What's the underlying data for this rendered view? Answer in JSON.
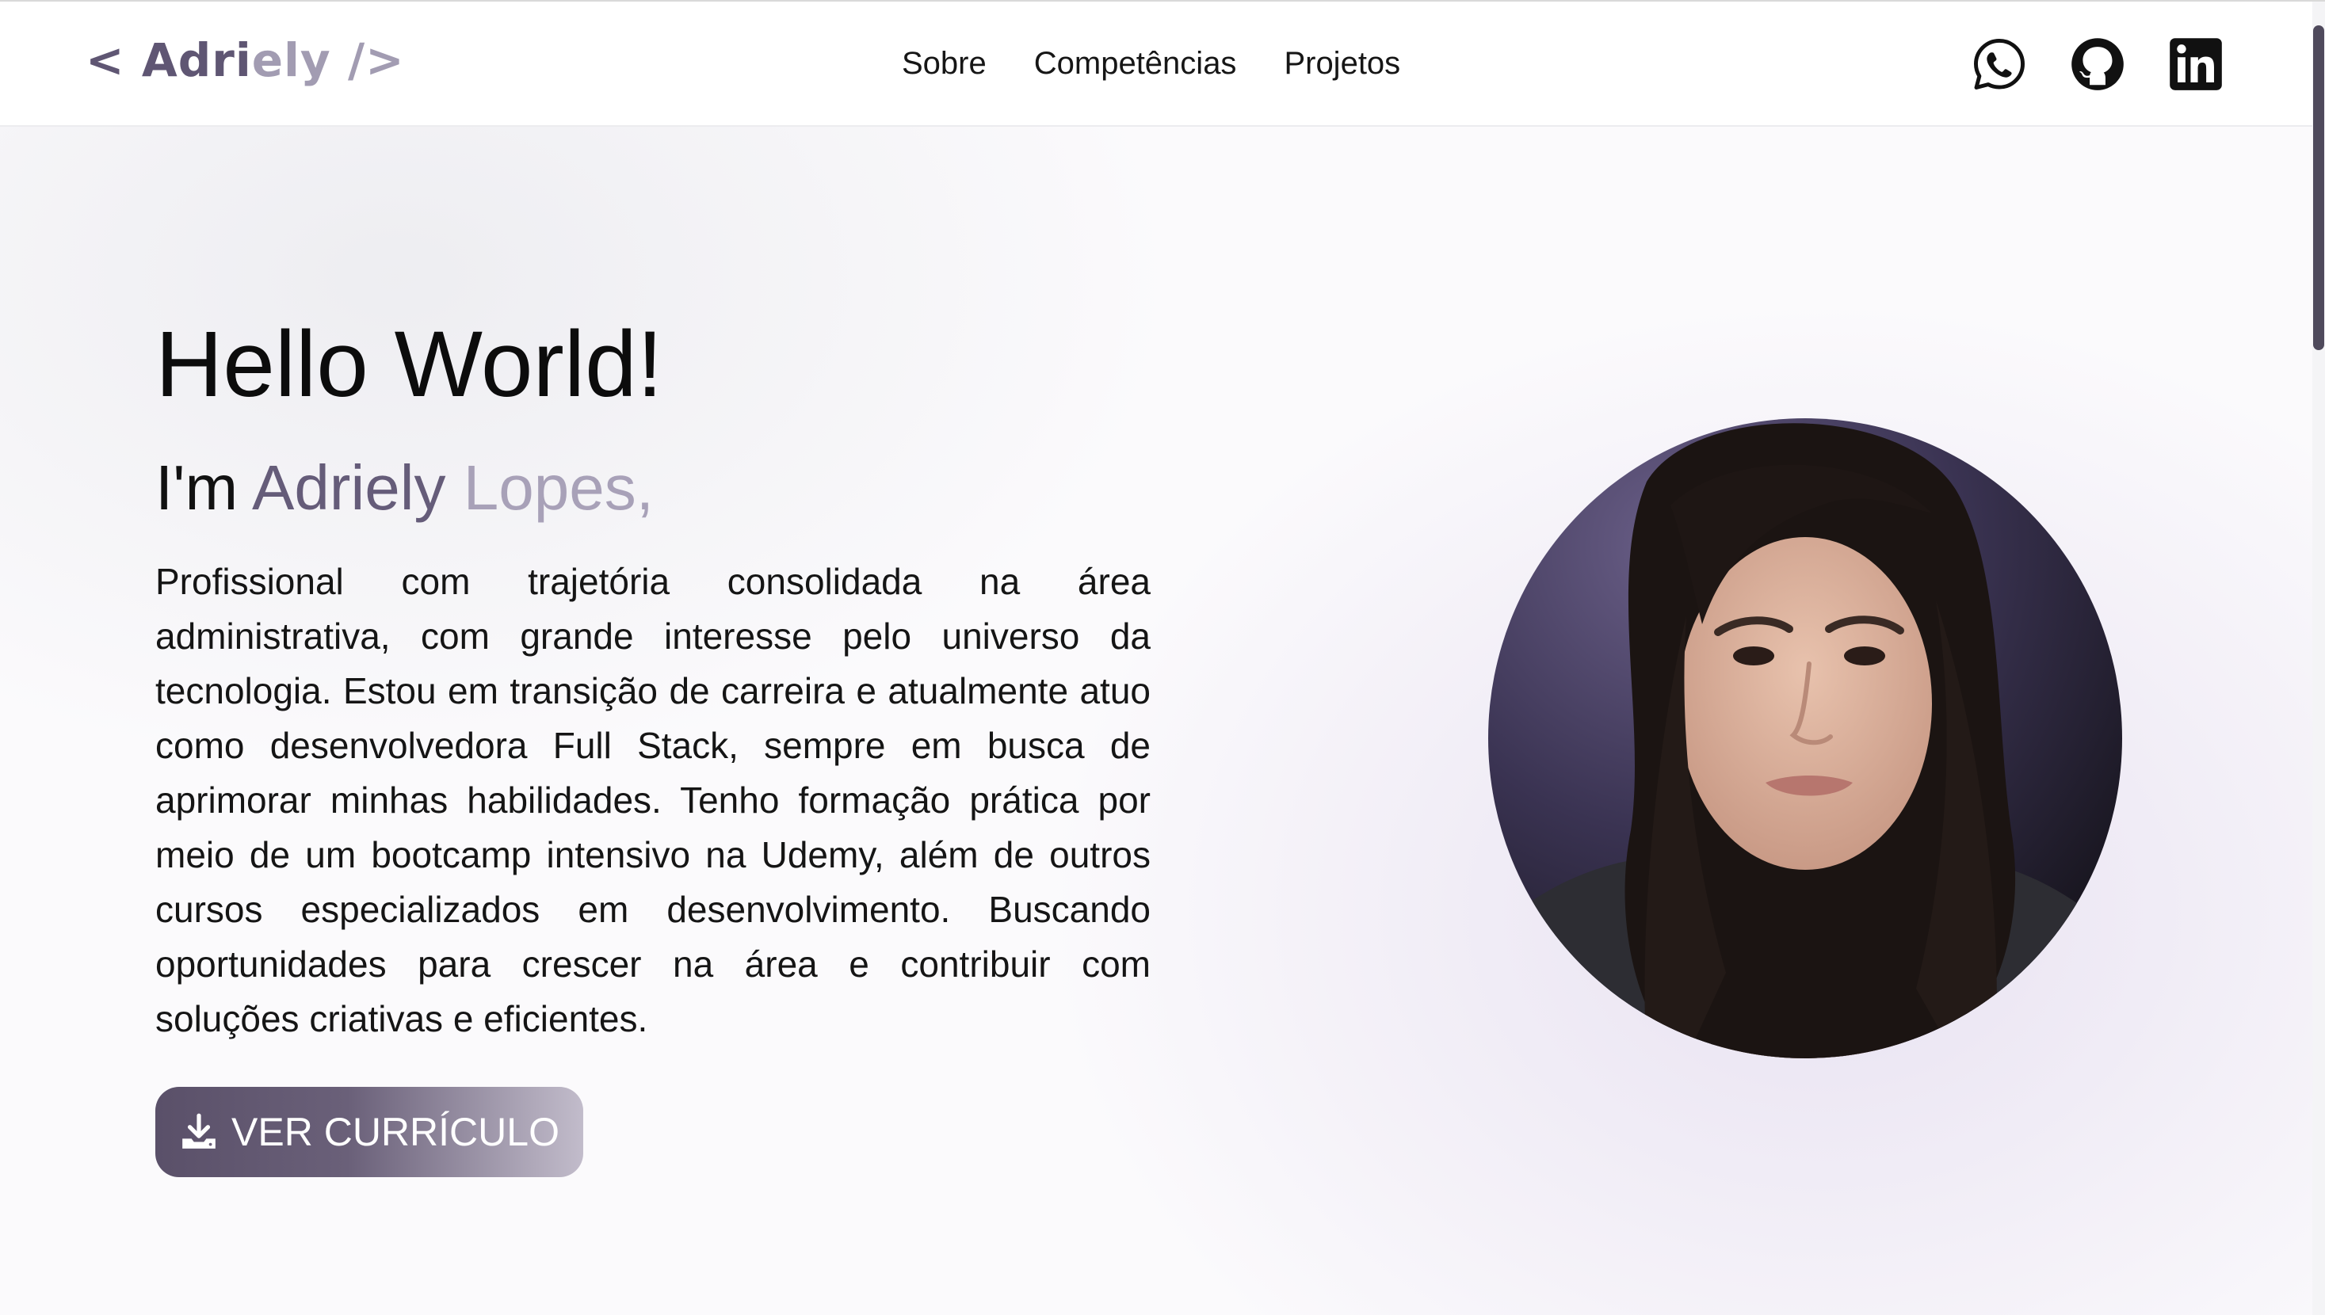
{
  "header": {
    "logo": {
      "open": "<",
      "name_main": "Adri",
      "name_tail": "ely",
      "slash": "/",
      "close": ">"
    },
    "nav": [
      "Sobre",
      "Competências",
      "Projetos"
    ],
    "social_icons": [
      "whatsapp-icon",
      "github-icon",
      "linkedin-icon"
    ]
  },
  "hero": {
    "title": "Hello World!",
    "greeting": "I'm",
    "first_name": "Adriely",
    "last_name": "Lopes,",
    "description": "Profissional com trajetória consolidada na área administrativa, com grande interesse pelo universo da tecnologia. Estou em transição de carreira e atualmente atuo como desenvolvedora Full Stack, sempre em busca de aprimorar minhas habilidades. Tenho formação prática por meio de um bootcamp intensivo na Udemy, além de outros cursos especializados em desenvolvimento. Buscando oportunidades para crescer na área e contribuir com soluções criativas e eficientes.",
    "cv_button": "VER CURRÍCULO",
    "cv_icon": "download-icon"
  },
  "colors": {
    "accent_dark": "#5f5673",
    "accent_light": "#a8a1b8",
    "text": "#151515"
  }
}
